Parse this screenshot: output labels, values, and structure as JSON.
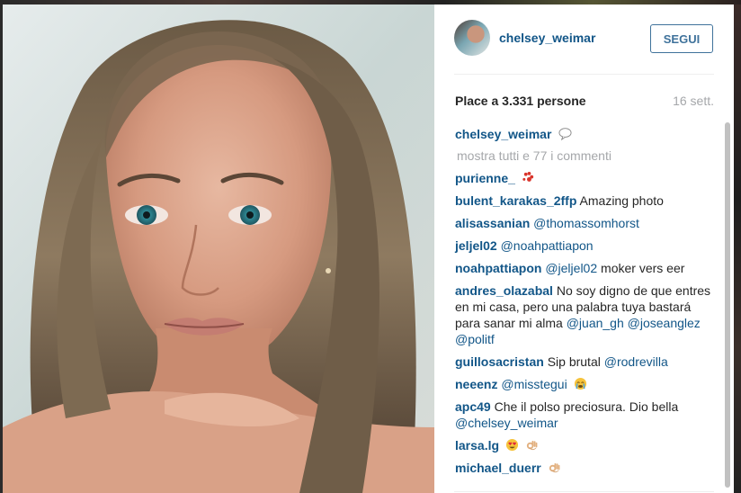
{
  "post": {
    "username": "chelsey_weimar",
    "follow_label": "SEGUI",
    "likes_text": "Place a 3.331 persone",
    "time_text": "16 sett.",
    "caption_user": "chelsey_weimar",
    "caption_emoji": "speech-bubble-icon",
    "show_all_comments": "mostra tutti e 77 i commenti"
  },
  "comments": [
    {
      "user": "purienne_",
      "text": "",
      "emoji": "paw-prints-icon"
    },
    {
      "user": "bulent_karakas_2ffp",
      "text": "Amazing photo"
    },
    {
      "user": "alisassanian",
      "mention": "@thomassomhorst"
    },
    {
      "user": "jeljel02",
      "mention": "@noahpattiapon"
    },
    {
      "user": "noahpattiapon",
      "mention": "@jeljel02",
      "text": "moker vers eer"
    },
    {
      "user": "andres_olazabal",
      "text": "No soy digno de que entres en mi casa, pero una palabra tuya bastará para sanar mi alma",
      "mention1": "@juan_gh",
      "mention2": "@joseanglez",
      "mention3": "@politf"
    },
    {
      "user": "guillosacristan",
      "text": "Sip brutal",
      "mention": "@rodrevilla"
    },
    {
      "user": "neeenz",
      "mention": "@misstegui",
      "emoji": "crying-face-icon"
    },
    {
      "user": "apc49",
      "text": "Che il polso preciosura. Dio bella",
      "mention": "@chelsey_weimar"
    },
    {
      "user": "larsa.lg",
      "emoji": "heart-eyes-icon",
      "emoji2": "ok-hand-icon"
    },
    {
      "user": "michael_duerr",
      "emoji": "ok-hand-icon"
    }
  ],
  "colors": {
    "link": "#125688",
    "button": "#3f729b",
    "muted": "#a5a7aa",
    "text": "#262626"
  }
}
